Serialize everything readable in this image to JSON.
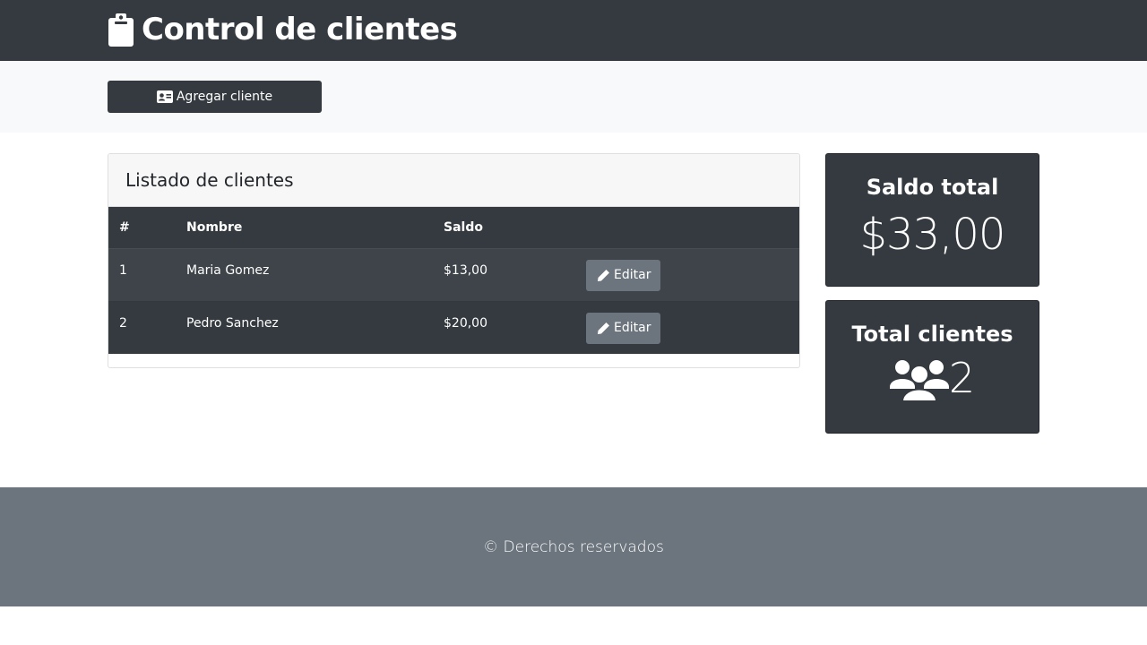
{
  "header": {
    "title": "Control de clientes",
    "icon": "clipboard-icon"
  },
  "actions": {
    "add_label": "Agregar cliente",
    "add_icon": "id-card-icon"
  },
  "client_list": {
    "title": "Listado de clientes",
    "columns": [
      "#",
      "Nombre",
      "Saldo",
      ""
    ],
    "rows": [
      {
        "num": "1",
        "name": "Maria Gomez",
        "saldo": "$13,00",
        "edit_label": "Editar"
      },
      {
        "num": "2",
        "name": "Pedro Sanchez",
        "saldo": "$20,00",
        "edit_label": "Editar"
      }
    ]
  },
  "summary": {
    "saldo_title": "Saldo total",
    "saldo_value": "$33,00",
    "total_title": "Total clientes",
    "total_value": "2",
    "total_icon": "users-icon"
  },
  "footer": {
    "text": "© Derechos reservados"
  },
  "colors": {
    "dark": "#343a40",
    "secondary": "#6c757d",
    "light": "#f8f9fa"
  }
}
